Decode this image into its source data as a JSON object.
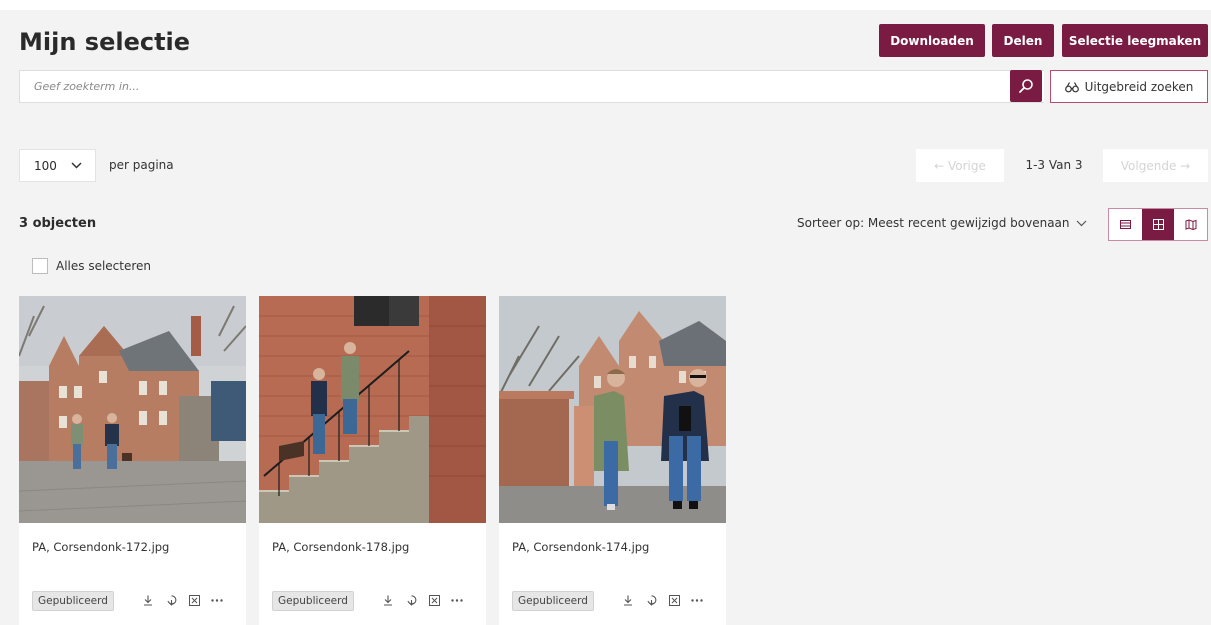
{
  "page": {
    "title": "Mijn selectie"
  },
  "toolbar": {
    "download_label": "Downloaden",
    "share_label": "Delen",
    "clear_label": "Selectie leegmaken"
  },
  "search": {
    "placeholder": "Geef zoekterm in...",
    "advanced_label": "Uitgebreid zoeken"
  },
  "pagination": {
    "per_page_value": "100",
    "per_page_label": "per pagina",
    "prev_label": "← Vorige",
    "info": "1-3 Van 3",
    "next_label": "Volgende →"
  },
  "results": {
    "count_label": "3 objecten",
    "sort_label": "Sorteer op: Meest recent gewijzigd bovenaan",
    "select_all_label": "Alles selecteren",
    "view_modes": [
      "list-view-icon",
      "grid-view-icon",
      "map-view-icon"
    ],
    "active_view": "grid"
  },
  "items": [
    {
      "name": "PA, Corsendonk-172.jpg",
      "status": "Gepubliceerd"
    },
    {
      "name": "PA, Corsendonk-178.jpg",
      "status": "Gepubliceerd"
    },
    {
      "name": "PA, Corsendonk-174.jpg",
      "status": "Gepubliceerd"
    }
  ],
  "colors": {
    "accent": "#7a1b44",
    "background": "#f3f3f3"
  }
}
